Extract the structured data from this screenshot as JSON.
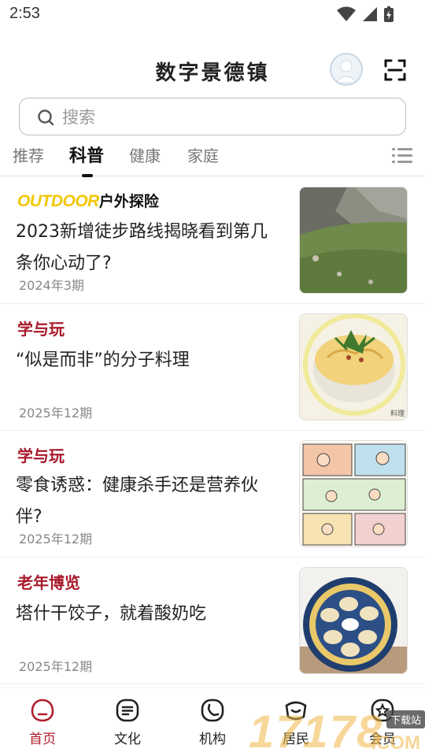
{
  "status_bar": {
    "time": "2:53"
  },
  "header": {
    "title": "数字景德镇"
  },
  "search": {
    "placeholder": "搜索"
  },
  "tabs": [
    {
      "label": "推荐",
      "active": false
    },
    {
      "label": "科普",
      "active": true
    },
    {
      "label": "健康",
      "active": false
    },
    {
      "label": "家庭",
      "active": false
    }
  ],
  "articles": [
    {
      "source_en": "OUTDOOR",
      "source_zh": "户外探险",
      "title": "2023新增徒步路线揭晓看到第几条你心动了?",
      "date": "2024年3期"
    },
    {
      "source": "学与玩",
      "title": "“似是而非”的分子料理",
      "date": "2025年12期",
      "thumb_caption": "料理"
    },
    {
      "source": "学与玩",
      "title": "零食诱惑：健康杀手还是营养伙伴?",
      "date": "2025年12期"
    },
    {
      "source": "老年博览",
      "title": "塔什干饺子，就着酸奶吃",
      "date": "2025年12期"
    }
  ],
  "bottom_nav": [
    {
      "label": "首页",
      "icon": "home-icon",
      "active": true
    },
    {
      "label": "文化",
      "icon": "culture-icon",
      "active": false
    },
    {
      "label": "机构",
      "icon": "institution-icon",
      "active": false
    },
    {
      "label": "居民",
      "icon": "resident-icon",
      "active": false
    },
    {
      "label": "会员",
      "icon": "member-icon",
      "active": false
    }
  ],
  "watermark": {
    "number": "17178",
    "tag": "下载站",
    "suffix": ".COM"
  },
  "colors": {
    "accent": "#b01e2e",
    "outdoor_yellow": "#f2c600",
    "source_red": "#a8192b"
  }
}
